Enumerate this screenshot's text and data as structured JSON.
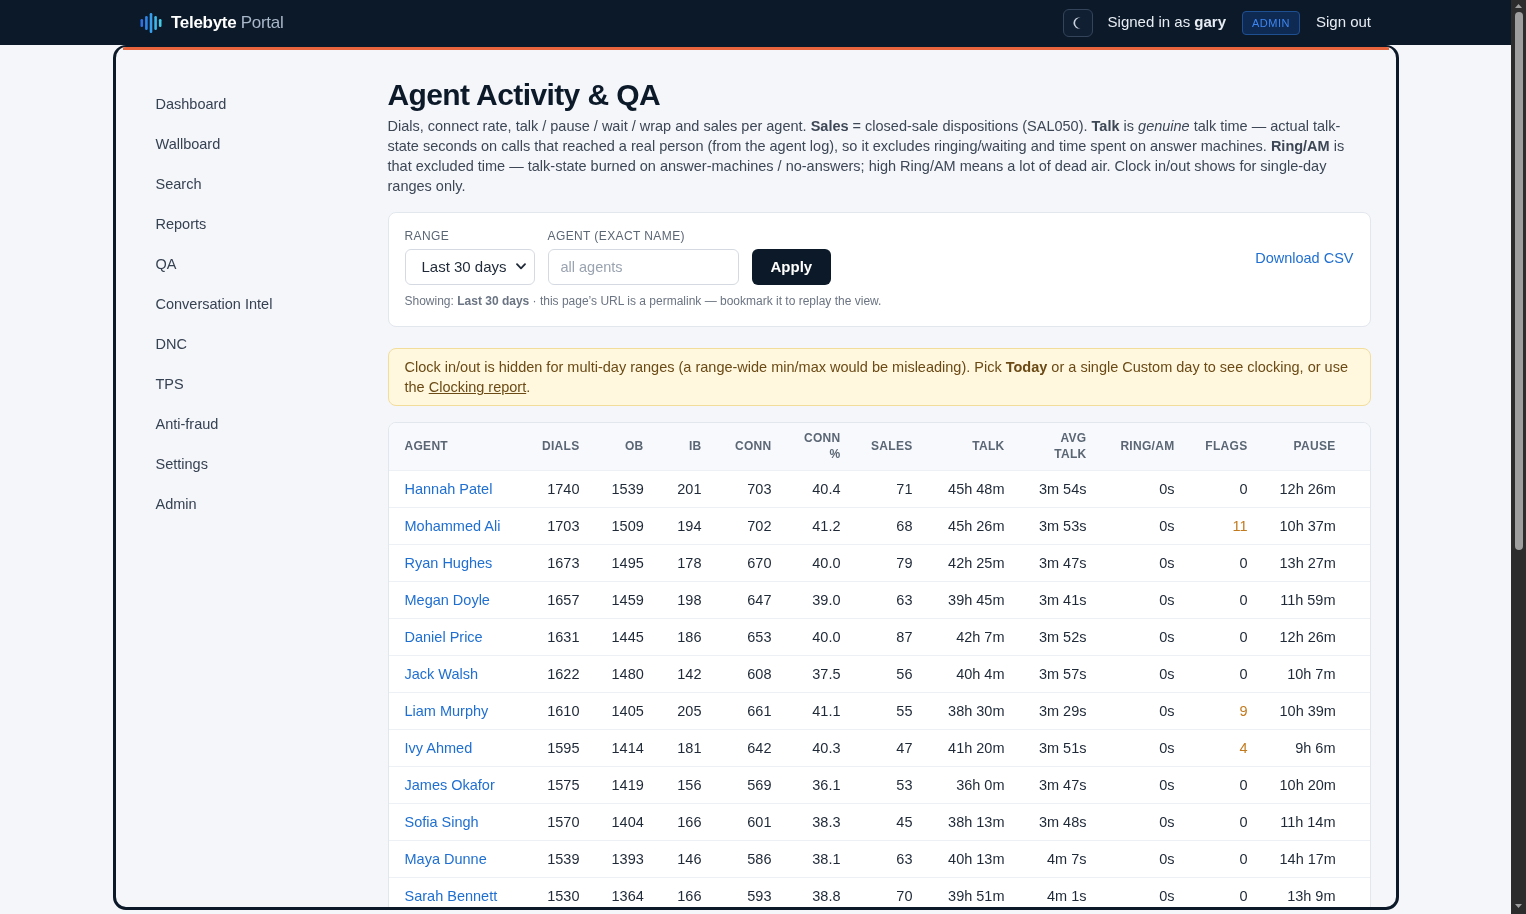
{
  "navbar": {
    "brand": {
      "name": "Telebyte",
      "suffix": "Portal"
    },
    "signed_in": "Signed in as **gary**",
    "role_badge": "ADMIN",
    "sign_out": "Sign out"
  },
  "sidebar": {
    "items": [
      "Dashboard",
      "Wallboard",
      "Search",
      "Reports",
      "QA",
      "Conversation Intel",
      "DNC",
      "TPS",
      "Anti-fraud",
      "Settings",
      "Admin"
    ]
  },
  "page": {
    "title": "Agent Activity & QA",
    "description": "Dials, connect rate, talk / pause / wait / wrap and sales per agent. **Sales** = closed-sale dispositions (SAL050). **Talk** is *genuine* talk time — actual talk-state seconds on calls that reached a real person (from the agent log), so it excludes ringing/waiting and time spent on answer machines. **Ring/AM** is that excluded time — talk-state burned on answer-machines / no-answers; high Ring/AM means a lot of dead air. Clock in/out shows for single-day ranges only."
  },
  "filters": {
    "range": {
      "label": "RANGE",
      "value": "Last 30 days"
    },
    "agent": {
      "label": "AGENT (EXACT NAME)",
      "placeholder": "all agents"
    },
    "apply_button": "Apply",
    "download_link": "Download CSV",
    "note": "Showing: **Last 30 days** · this page’s URL is a permalink — bookmark it to replay the view."
  },
  "alert": {
    "text": "Clock in/out is hidden for multi-day ranges (a range-wide min/max would be misleading). Pick **Today** or a single Custom day to see clocking, or use the ",
    "link": "Clocking report",
    "text_after": "."
  },
  "table": {
    "columns": [
      "AGENT",
      "DIALS",
      "OB",
      "IB",
      "CONN",
      "CONN %",
      "SALES",
      "TALK",
      "AVG TALK",
      "RING/AM",
      "FLAGS",
      "PAUSE"
    ],
    "rows": [
      {
        "agent": "Hannah Patel",
        "dials": "1740",
        "ob": "1539",
        "ib": "201",
        "conn": "703",
        "conn_pct": "40.4",
        "sales": "71",
        "talk": "45h 48m",
        "avg_talk": "3m 54s",
        "ring_am": "0s",
        "flags": "0",
        "flagged": false,
        "pause": "12h 26m"
      },
      {
        "agent": "Mohammed Ali",
        "dials": "1703",
        "ob": "1509",
        "ib": "194",
        "conn": "702",
        "conn_pct": "41.2",
        "sales": "68",
        "talk": "45h 26m",
        "avg_talk": "3m 53s",
        "ring_am": "0s",
        "flags": "11",
        "flagged": true,
        "pause": "10h 37m"
      },
      {
        "agent": "Ryan Hughes",
        "dials": "1673",
        "ob": "1495",
        "ib": "178",
        "conn": "670",
        "conn_pct": "40.0",
        "sales": "79",
        "talk": "42h 25m",
        "avg_talk": "3m 47s",
        "ring_am": "0s",
        "flags": "0",
        "flagged": false,
        "pause": "13h 27m"
      },
      {
        "agent": "Megan Doyle",
        "dials": "1657",
        "ob": "1459",
        "ib": "198",
        "conn": "647",
        "conn_pct": "39.0",
        "sales": "63",
        "talk": "39h 45m",
        "avg_talk": "3m 41s",
        "ring_am": "0s",
        "flags": "0",
        "flagged": false,
        "pause": "11h 59m"
      },
      {
        "agent": "Daniel Price",
        "dials": "1631",
        "ob": "1445",
        "ib": "186",
        "conn": "653",
        "conn_pct": "40.0",
        "sales": "87",
        "talk": "42h 7m",
        "avg_talk": "3m 52s",
        "ring_am": "0s",
        "flags": "0",
        "flagged": false,
        "pause": "12h 26m"
      },
      {
        "agent": "Jack Walsh",
        "dials": "1622",
        "ob": "1480",
        "ib": "142",
        "conn": "608",
        "conn_pct": "37.5",
        "sales": "56",
        "talk": "40h 4m",
        "avg_talk": "3m 57s",
        "ring_am": "0s",
        "flags": "0",
        "flagged": false,
        "pause": "10h 7m"
      },
      {
        "agent": "Liam Murphy",
        "dials": "1610",
        "ob": "1405",
        "ib": "205",
        "conn": "661",
        "conn_pct": "41.1",
        "sales": "55",
        "talk": "38h 30m",
        "avg_talk": "3m 29s",
        "ring_am": "0s",
        "flags": "9",
        "flagged": true,
        "pause": "10h 39m"
      },
      {
        "agent": "Ivy Ahmed",
        "dials": "1595",
        "ob": "1414",
        "ib": "181",
        "conn": "642",
        "conn_pct": "40.3",
        "sales": "47",
        "talk": "41h 20m",
        "avg_talk": "3m 51s",
        "ring_am": "0s",
        "flags": "4",
        "flagged": true,
        "pause": "9h 6m"
      },
      {
        "agent": "James Okafor",
        "dials": "1575",
        "ob": "1419",
        "ib": "156",
        "conn": "569",
        "conn_pct": "36.1",
        "sales": "53",
        "talk": "36h 0m",
        "avg_talk": "3m 47s",
        "ring_am": "0s",
        "flags": "0",
        "flagged": false,
        "pause": "10h 20m"
      },
      {
        "agent": "Sofia Singh",
        "dials": "1570",
        "ob": "1404",
        "ib": "166",
        "conn": "601",
        "conn_pct": "38.3",
        "sales": "45",
        "talk": "38h 13m",
        "avg_talk": "3m 48s",
        "ring_am": "0s",
        "flags": "0",
        "flagged": false,
        "pause": "11h 14m"
      },
      {
        "agent": "Maya Dunne",
        "dials": "1539",
        "ob": "1393",
        "ib": "146",
        "conn": "586",
        "conn_pct": "38.1",
        "sales": "63",
        "talk": "40h 13m",
        "avg_talk": "4m 7s",
        "ring_am": "0s",
        "flags": "0",
        "flagged": false,
        "pause": "14h 17m"
      },
      {
        "agent": "Sarah Bennett",
        "dials": "1530",
        "ob": "1364",
        "ib": "166",
        "conn": "593",
        "conn_pct": "38.8",
        "sales": "70",
        "talk": "39h 51m",
        "avg_talk": "4m 1s",
        "ring_am": "0s",
        "flags": "0",
        "flagged": false,
        "pause": "13h 9m"
      }
    ]
  }
}
